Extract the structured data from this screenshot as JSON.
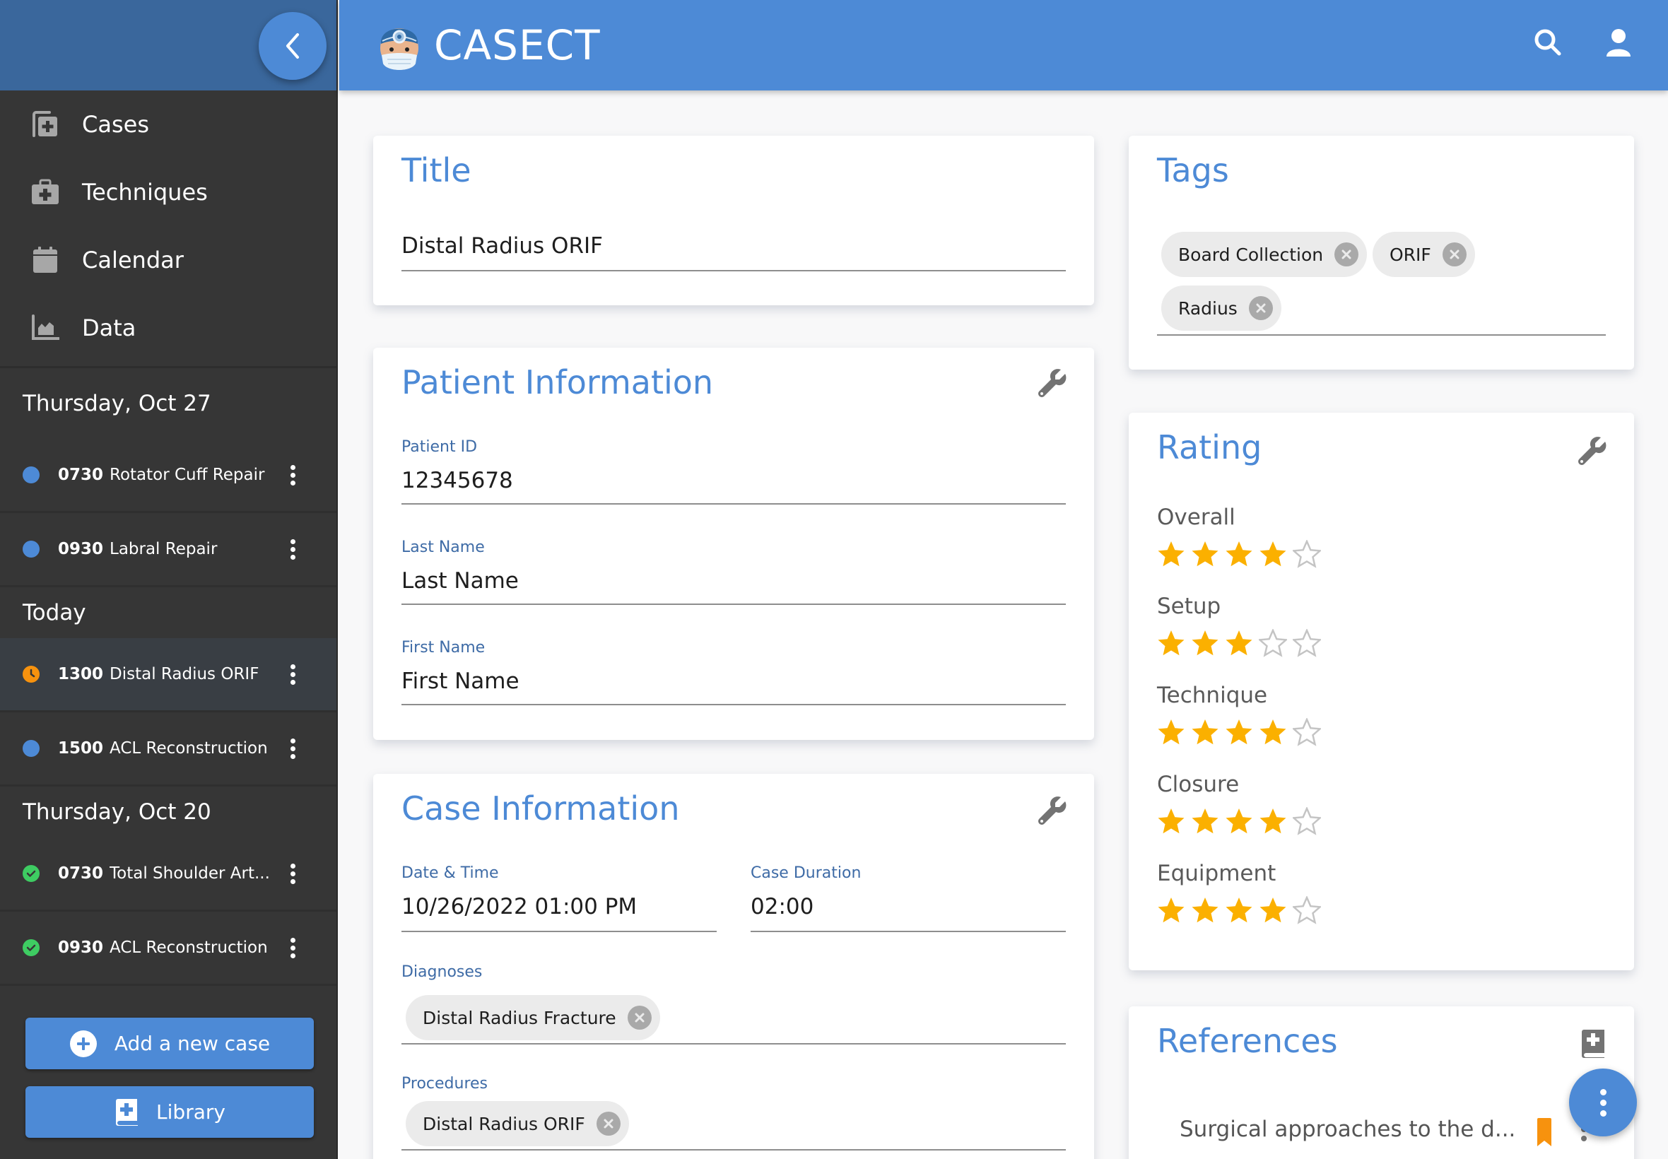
{
  "app": {
    "title": "CASECT"
  },
  "sidebar": {
    "nav": [
      {
        "label": "Cases",
        "icon": "cases-icon"
      },
      {
        "label": "Techniques",
        "icon": "medical-kit-icon"
      },
      {
        "label": "Calendar",
        "icon": "calendar-icon"
      },
      {
        "label": "Data",
        "icon": "chart-area-icon"
      }
    ],
    "groups": [
      {
        "day": "Thursday, Oct 27",
        "cases": [
          {
            "time": "0730",
            "name": "Rotator Cuff Repair",
            "status": "scheduled"
          },
          {
            "time": "0930",
            "name": "Labral Repair",
            "status": "scheduled"
          }
        ]
      },
      {
        "day": "Today",
        "cases": [
          {
            "time": "1300",
            "name": "Distal Radius ORIF",
            "status": "in-progress",
            "selected": true
          },
          {
            "time": "1500",
            "name": "ACL Reconstruction",
            "status": "scheduled"
          }
        ]
      },
      {
        "day": "Thursday, Oct 20",
        "cases": [
          {
            "time": "0730",
            "name": "Total Shoulder Art...",
            "status": "completed"
          },
          {
            "time": "0930",
            "name": "ACL Reconstruction",
            "status": "completed"
          }
        ]
      }
    ],
    "add_case_label": "Add a new case",
    "library_label": "Library"
  },
  "colors": {
    "accent": "#4d8ad6",
    "scheduled": "#4d8ad6",
    "in_progress": "#f7920e",
    "completed": "#3ecc62",
    "star_filled": "#fbb000",
    "star_empty": "#c4c4c4",
    "bookmark": "#f7920e"
  },
  "title_card": {
    "heading": "Title",
    "value": "Distal Radius ORIF"
  },
  "patient": {
    "heading": "Patient Information",
    "fields": [
      {
        "label": "Patient ID",
        "value": "12345678"
      },
      {
        "label": "Last Name",
        "value": "Last Name"
      },
      {
        "label": "First Name",
        "value": "First Name"
      }
    ]
  },
  "case_info": {
    "heading": "Case Information",
    "date_label": "Date & Time",
    "date_value": "10/26/2022 01:00 PM",
    "duration_label": "Case Duration",
    "duration_value": "02:00",
    "diagnoses_label": "Diagnoses",
    "diagnoses": [
      "Distal Radius Fracture"
    ],
    "procedures_label": "Procedures",
    "procedures": [
      "Distal Radius ORIF"
    ]
  },
  "tags": {
    "heading": "Tags",
    "items": [
      "Board Collection",
      "ORIF",
      "Radius"
    ]
  },
  "rating": {
    "heading": "Rating",
    "max": 5,
    "items": [
      {
        "label": "Overall",
        "value": 4
      },
      {
        "label": "Setup",
        "value": 3
      },
      {
        "label": "Technique",
        "value": 4
      },
      {
        "label": "Closure",
        "value": 4
      },
      {
        "label": "Equipment",
        "value": 4
      }
    ]
  },
  "references": {
    "heading": "References",
    "items": [
      {
        "title": "Surgical approaches to the d...",
        "bookmarked": true
      }
    ]
  }
}
